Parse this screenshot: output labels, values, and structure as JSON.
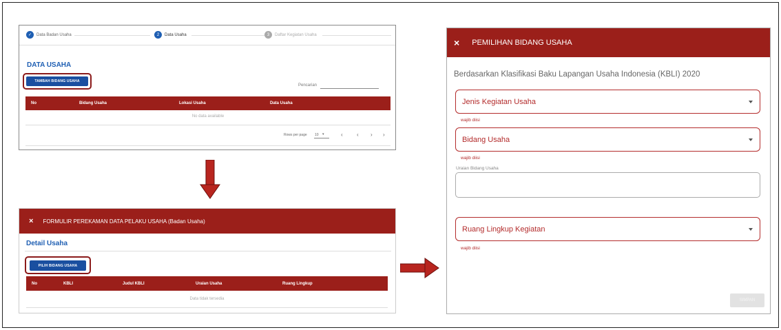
{
  "panel1": {
    "steps": [
      {
        "number": "✓",
        "label": "Data Badan Usaha",
        "state": "done"
      },
      {
        "number": "2",
        "label": "Data Usaha",
        "state": "active"
      },
      {
        "number": "3",
        "label": "Daftar Kegiatan Usaha",
        "state": "inactive"
      }
    ],
    "title": "DATA USAHA",
    "add_button": "TAMBAH BIDANG USAHA",
    "search_label": "Pencarian",
    "columns": [
      "No",
      "Bidang Usaha",
      "Lokasi Usaha",
      "Data Usaha"
    ],
    "empty_text": "No data available",
    "pager": {
      "rows_label": "Rows per page",
      "rows_value": "10",
      "prev": "‹",
      "next": "›"
    }
  },
  "panel2": {
    "header_title": "FORMULIR PEREKAMAN DATA PELAKU USAHA (Badan Usaha)",
    "close": "×",
    "title": "Detail Usaha",
    "pick_button": "PILIH BIDANG USAHA",
    "columns": [
      "No",
      "KBLI",
      "Judul KBLI",
      "Uraian Usaha",
      "Ruang Lingkup"
    ],
    "empty_text": "Data tidak tersedia"
  },
  "panel3": {
    "header_title": "PEMILIHAN BIDANG USAHA",
    "close": "×",
    "kbli_text": "Berdasarkan Klasifikasi Baku Lapangan Usaha Indonesia (KBLI) 2020",
    "field_jenis": "Jenis Kegiatan Usaha",
    "field_bidang": "Bidang Usaha",
    "field_ruang": "Ruang Lingkup Kegiatan",
    "helper": "wajib diisi",
    "textarea_label": "Uraian Bidang Usaha",
    "submit_label": "SIMPAN"
  },
  "colors": {
    "header_red": "#9b1f1a",
    "button_blue": "#1a4fa0",
    "error_red": "#b32b2b"
  }
}
